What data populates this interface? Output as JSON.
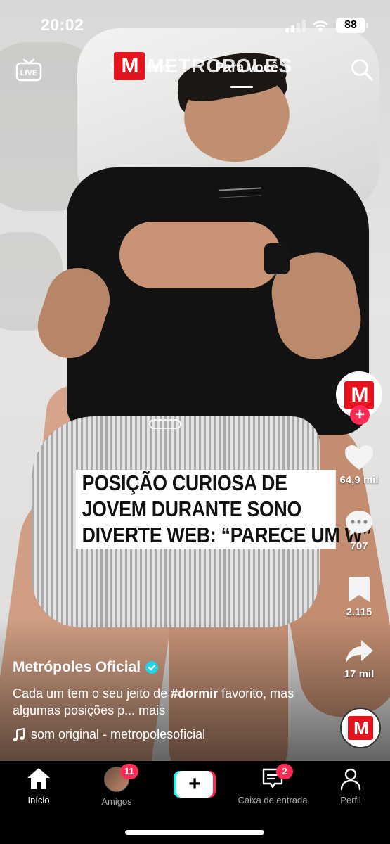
{
  "status_bar": {
    "time": "20:02",
    "battery": "88"
  },
  "top_nav": {
    "live_label": "LIVE",
    "tabs": [
      {
        "label": "Seguindo",
        "active": false
      },
      {
        "label": "Para você",
        "active": true
      }
    ],
    "watermark": "METRÓPOLES",
    "search_icon": "search-icon"
  },
  "video": {
    "headline_lines": [
      "POSIÇÃO CURIOSA DE",
      "JOVEM DURANTE SONO",
      "DIVERTE WEB: “PARECE UM W”"
    ]
  },
  "actions": {
    "likes": "64,9 mil",
    "comments": "707",
    "saves": "2.115",
    "shares": "17 mil"
  },
  "caption": {
    "username": "Metrópoles Oficial",
    "desc_before": "Cada um tem o seu jeito de ",
    "hashtag": "#dormir",
    "desc_after": " favorito, mas algumas posições p... ",
    "more": "mais",
    "sound": "som original - metropolesoficial"
  },
  "bottom_nav": {
    "items": [
      {
        "label": "Início",
        "icon": "home-icon",
        "active": true
      },
      {
        "label": "Amigos",
        "icon": "friends-avatar",
        "badge": "11"
      },
      {
        "label": "",
        "icon": "plus-icon"
      },
      {
        "label": "Caixa de entrada",
        "icon": "inbox-icon",
        "badge": "2"
      },
      {
        "label": "Perfil",
        "icon": "profile-icon"
      }
    ]
  },
  "colors": {
    "accent": "#fe2c55",
    "cyan": "#25f4ee",
    "brand_red": "#e3141d"
  }
}
